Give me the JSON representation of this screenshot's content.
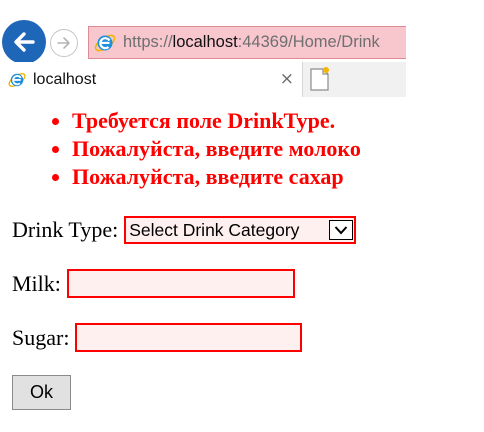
{
  "browser": {
    "url_prefix": "https://",
    "url_host": "localhost",
    "url_rest": ":44369/Home/Drink",
    "tab_title": "localhost",
    "tab_close": "×",
    "icons": {
      "back": "back-arrow-icon",
      "forward": "forward-arrow-icon",
      "site": "internet-explorer-icon",
      "new_tab": "new-tab-icon"
    },
    "colors": {
      "back_button": "#1e67b8",
      "address_bar_bg": "#f7c7cd"
    }
  },
  "validation_summary": {
    "color": "#ff0000",
    "errors": [
      "Требуется поле DrinkType.",
      "Пожалуйста, введите молоко",
      "Пожалуйста, введите сахар"
    ]
  },
  "form": {
    "drink_type": {
      "label": "Drink Type:",
      "selected": "Select Drink Category"
    },
    "milk": {
      "label": "Milk:",
      "value": ""
    },
    "sugar": {
      "label": "Sugar:",
      "value": ""
    },
    "submit_label": "Ok",
    "invalid_border_color": "#ff0000",
    "invalid_bg_color": "#fff0f0"
  }
}
